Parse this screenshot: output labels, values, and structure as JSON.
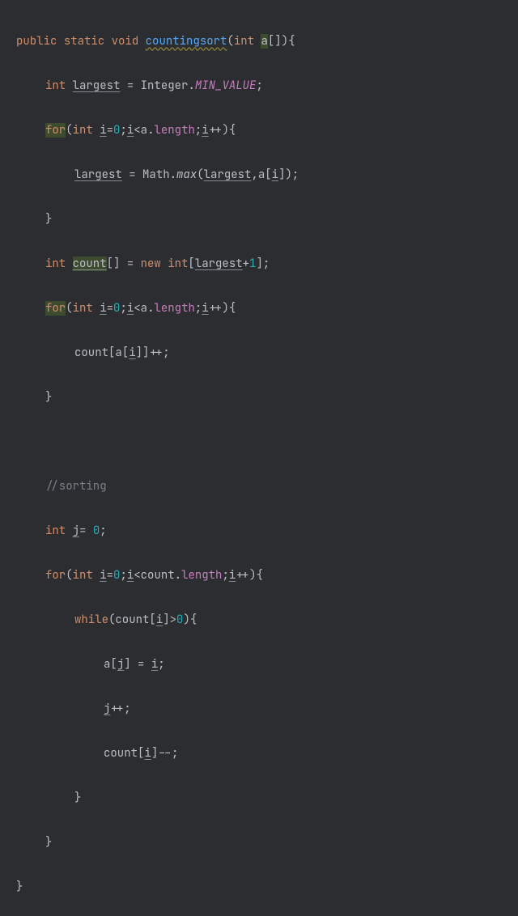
{
  "code": {
    "l1": {
      "public": "public",
      "static": "static",
      "void": "void",
      "fn": "countingsort",
      "int": "int",
      "a": "a",
      "brackets": "[]"
    },
    "l2": {
      "int": "int",
      "largest": "largest",
      "eq": " = ",
      "Integer": "Integer",
      "dot": ".",
      "MIN_VALUE": "MIN_VALUE",
      "semi": ";"
    },
    "l3": {
      "for": "for",
      "int": "int",
      "i": "i",
      "eq": "=",
      "zero": "0",
      "semi1": ";",
      "cond_i": "i",
      "lt": "<",
      "a": "a",
      "dot": ".",
      "length": "length",
      "semi2": ";",
      "inc_i": "i",
      "pp": "++"
    },
    "l4": {
      "largest": "largest",
      "eq": " = ",
      "Math": "Math",
      "dot": ".",
      "max": "max",
      "largest2": "largest",
      "comma": ",",
      "a": "a",
      "i": "i",
      "close": "]);"
    },
    "l5": {
      "brace": "}"
    },
    "l6": {
      "int": "int",
      "count": "count",
      "br": "[] = ",
      "new": "new",
      "int2": "int",
      "ob": "[",
      "largest": "largest",
      "plus": "+",
      "one": "1",
      "cb": "];"
    },
    "l7": {
      "for": "for",
      "int": "int",
      "i": "i",
      "eq": "=",
      "zero": "0",
      "semi1": ";",
      "cond_i": "i",
      "lt": "<",
      "a": "a",
      "dot": ".",
      "length": "length",
      "semi2": ";",
      "inc_i": "i",
      "pp": "++"
    },
    "l8": {
      "count": "count",
      "ob": "[",
      "a": "a",
      "ob2": "[",
      "i": "i",
      "cb": "]]++;"
    },
    "l9": {
      "brace": "}"
    },
    "l10": {
      "comment": "//sorting"
    },
    "l11": {
      "int": "int",
      "j": "j",
      "eq": "= ",
      "zero": "0",
      "semi": ";"
    },
    "l12": {
      "for": "for",
      "int": "int",
      "i": "i",
      "eq": "=",
      "zero": "0",
      "semi1": ";",
      "cond_i": "i",
      "lt": "<",
      "count": "count",
      "dot": ".",
      "length": "length",
      "semi2": ";",
      "inc_i": "i",
      "pp": "++"
    },
    "l13": {
      "while": "while",
      "count": "count",
      "ob": "[",
      "i": "i",
      "cb": "]>",
      "zero": "0",
      "paren": "){"
    },
    "l14": {
      "a": "a",
      "ob": "[",
      "j": "j",
      "cb": "] = ",
      "i": "i",
      "semi": ";"
    },
    "l15": {
      "j": "j",
      "pp": "++;"
    },
    "l16": {
      "count": "count",
      "ob": "[",
      "i": "i",
      "cb": "]--;"
    },
    "l17": {
      "brace": "}"
    },
    "l18": {
      "brace": "}"
    },
    "l19": {
      "brace": "}"
    }
  }
}
